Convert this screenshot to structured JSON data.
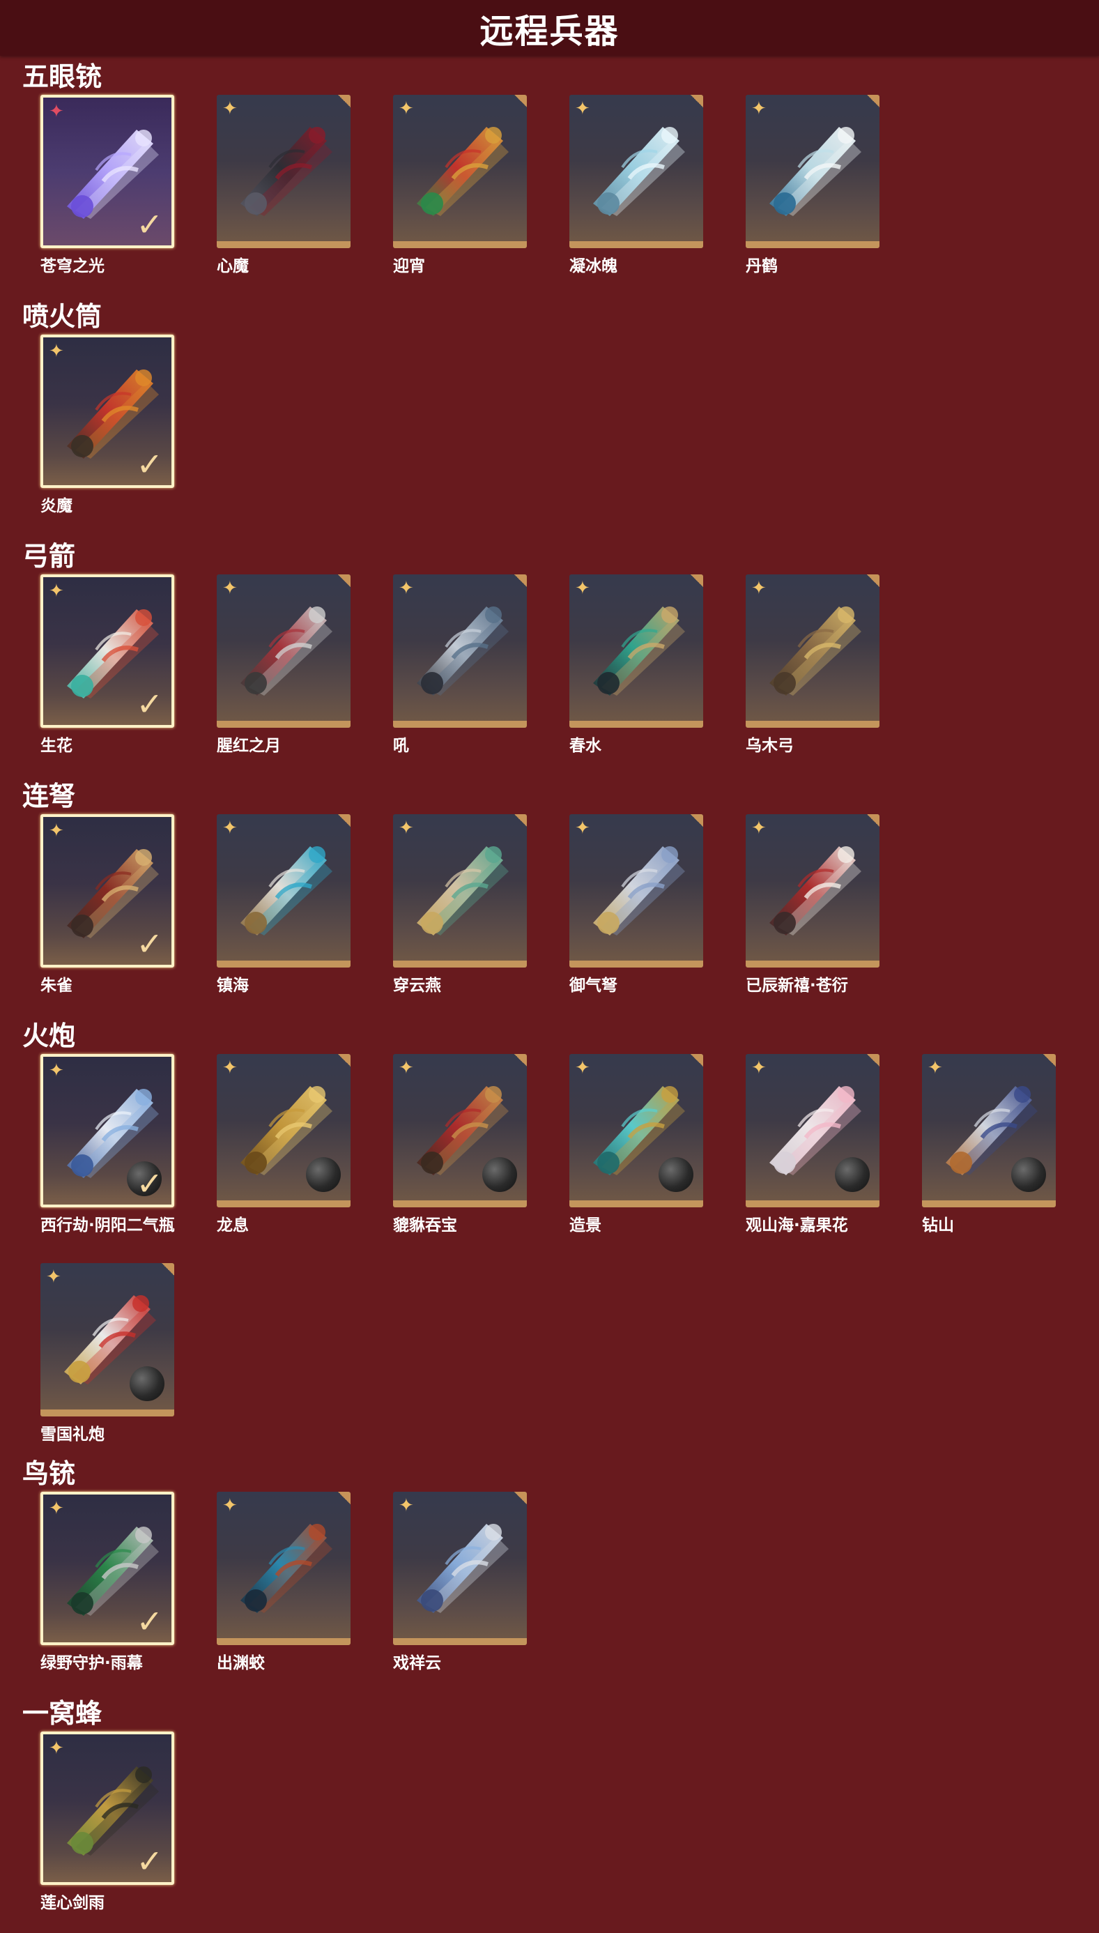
{
  "header": {
    "title": "远程兵器"
  },
  "sections": [
    {
      "title": "五眼铳",
      "items": [
        {
          "name": "苍穹之光",
          "selected": true,
          "equipped": true,
          "ammo": false,
          "rarity": "red",
          "icon": "weapon-violet-gun-icon"
        },
        {
          "name": "心魔",
          "selected": false,
          "ammo": false,
          "icon": "weapon-dark-gun-icon"
        },
        {
          "name": "迎宵",
          "selected": false,
          "ammo": false,
          "icon": "weapon-red-gatling-icon"
        },
        {
          "name": "凝冰魄",
          "selected": false,
          "ammo": false,
          "icon": "weapon-ice-gun-icon"
        },
        {
          "name": "丹鹤",
          "selected": false,
          "ammo": false,
          "icon": "weapon-crane-gun-icon"
        }
      ]
    },
    {
      "title": "喷火筒",
      "items": [
        {
          "name": "炎魔",
          "selected": true,
          "ammo": false,
          "icon": "weapon-flame-tube-icon"
        }
      ]
    },
    {
      "title": "弓箭",
      "items": [
        {
          "name": "生花",
          "selected": true,
          "ammo": false,
          "icon": "weapon-flower-bow-icon"
        },
        {
          "name": "腥红之月",
          "selected": false,
          "ammo": false,
          "icon": "weapon-crimson-bow-icon"
        },
        {
          "name": "吼",
          "selected": false,
          "ammo": false,
          "icon": "weapon-roar-bow-icon"
        },
        {
          "name": "春水",
          "selected": false,
          "ammo": false,
          "icon": "weapon-jade-bow-icon"
        },
        {
          "name": "乌木弓",
          "selected": false,
          "ammo": false,
          "icon": "weapon-wood-bow-icon"
        }
      ]
    },
    {
      "title": "连弩",
      "items": [
        {
          "name": "朱雀",
          "selected": true,
          "ammo": false,
          "icon": "weapon-phoenix-crossbow-icon"
        },
        {
          "name": "镇海",
          "selected": false,
          "ammo": false,
          "icon": "weapon-sea-crossbow-icon"
        },
        {
          "name": "穿云燕",
          "selected": false,
          "ammo": false,
          "icon": "weapon-swallow-crossbow-icon"
        },
        {
          "name": "御气弩",
          "selected": false,
          "ammo": false,
          "icon": "weapon-silver-crossbow-icon"
        },
        {
          "name": "已辰新禧·苍衍",
          "selected": false,
          "ammo": false,
          "icon": "weapon-festive-crossbow-icon"
        }
      ]
    },
    {
      "title": "火炮",
      "items": [
        {
          "name": "西行劫·阴阳二气瓶",
          "selected": true,
          "ammo": true,
          "icon": "weapon-horn-cannon-icon"
        },
        {
          "name": "龙息",
          "selected": false,
          "ammo": true,
          "icon": "weapon-dragon-cannon-icon"
        },
        {
          "name": "貔貅吞宝",
          "selected": false,
          "ammo": true,
          "icon": "weapon-pixiu-cannon-icon"
        },
        {
          "name": "造景",
          "selected": false,
          "ammo": true,
          "icon": "weapon-jade-cannon-icon"
        },
        {
          "name": "观山海·嘉果花",
          "selected": false,
          "ammo": true,
          "icon": "weapon-blossom-cannon-icon"
        },
        {
          "name": "钻山",
          "selected": false,
          "ammo": true,
          "icon": "weapon-drill-cannon-icon"
        },
        {
          "name": "雪国礼炮",
          "selected": false,
          "ammo": true,
          "icon": "weapon-snow-cannon-icon"
        }
      ]
    },
    {
      "title": "鸟铳",
      "items": [
        {
          "name": "绿野守护·雨幕",
          "selected": true,
          "ammo": false,
          "icon": "weapon-green-musket-icon"
        },
        {
          "name": "出渊蛟",
          "selected": false,
          "ammo": false,
          "icon": "weapon-serpent-musket-icon"
        },
        {
          "name": "戏祥云",
          "selected": false,
          "ammo": false,
          "icon": "weapon-cloud-musket-icon"
        }
      ]
    },
    {
      "title": "一窝蜂",
      "items": [
        {
          "name": "莲心剑雨",
          "selected": true,
          "ammo": false,
          "icon": "weapon-lotus-rocket-icon"
        }
      ]
    }
  ],
  "symbols": {
    "rarity": "✦",
    "check": "✓"
  },
  "colors": {
    "background": "#681a1e",
    "header": "#4a0e13",
    "card_border": "#c4955c",
    "selected_border": "#fff2c8",
    "rarity_gold": "#f3c56a",
    "rarity_red": "#e14d62"
  }
}
